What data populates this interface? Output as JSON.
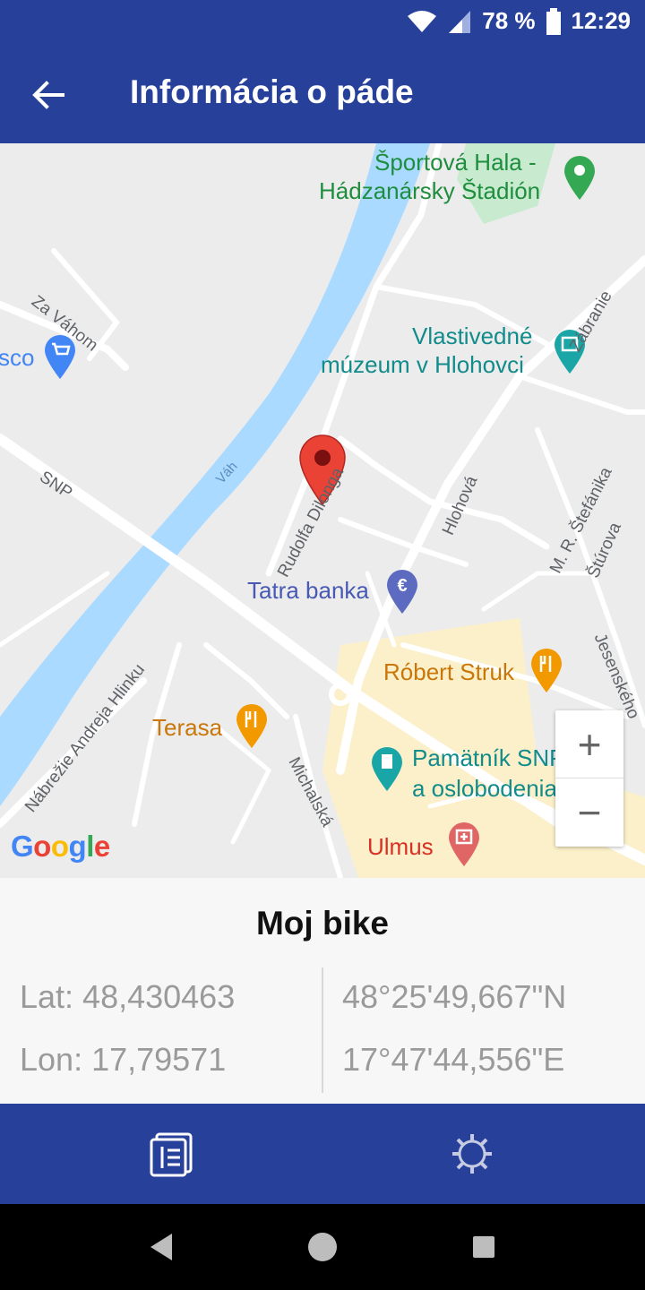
{
  "status_bar": {
    "battery": "78 %",
    "time": "12:29"
  },
  "app_bar": {
    "title": "Informácia o páde"
  },
  "map": {
    "pois": {
      "sport_hall_line1": "Športová Hala -",
      "sport_hall_line2": "Hádzanársky Štadión",
      "museum_line1": "Vlastivedné",
      "museum_line2": "múzeum v Hlohovci",
      "shop": "sco",
      "bank": "Tatra banka",
      "restaurant1": "Róbert Struk",
      "restaurant2": "Terasa",
      "monument_line1": "Pamätník SNP",
      "monument_line2": "a oslobodenia",
      "pharmacy": "Ulmus"
    },
    "streets": {
      "za_vahom": "Za Váhom",
      "snp": "SNP",
      "vah": "Váh",
      "rudolfa": "Rudolfa Dilonga",
      "hlohova": "Hlohová",
      "zabranie": "Zábranie",
      "stefanika": "M. R. Štefánika",
      "sturova": "Štúrova",
      "jesenskeho": "Jesenského",
      "nabrezie": "Nábrežie Andreja Hlinku",
      "michalska": "Michalská"
    },
    "zoom_in": "+",
    "zoom_out": "−",
    "logo": {
      "g1": "G",
      "o1": "o",
      "o2": "o",
      "g2": "g",
      "l": "l",
      "e": "e"
    },
    "colors": {
      "water": "#aadaff",
      "road": "#ffffff",
      "park": "#c8ebd0",
      "commercial": "#fbf0c9",
      "marker": "#ea4335"
    }
  },
  "info": {
    "name": "Moj bike",
    "lat": "Lat: 48,430463",
    "lon": "Lon: 17,79571",
    "lat_dms": "48°25'49,667\"N",
    "lon_dms": "17°47'44,556\"E"
  },
  "bottom_nav": {
    "items": [
      "list-icon",
      "gear-icon"
    ]
  },
  "system_nav": {
    "items": [
      "back-icon",
      "home-icon",
      "recents-icon"
    ]
  },
  "theme": {
    "primary": "#27419a"
  }
}
